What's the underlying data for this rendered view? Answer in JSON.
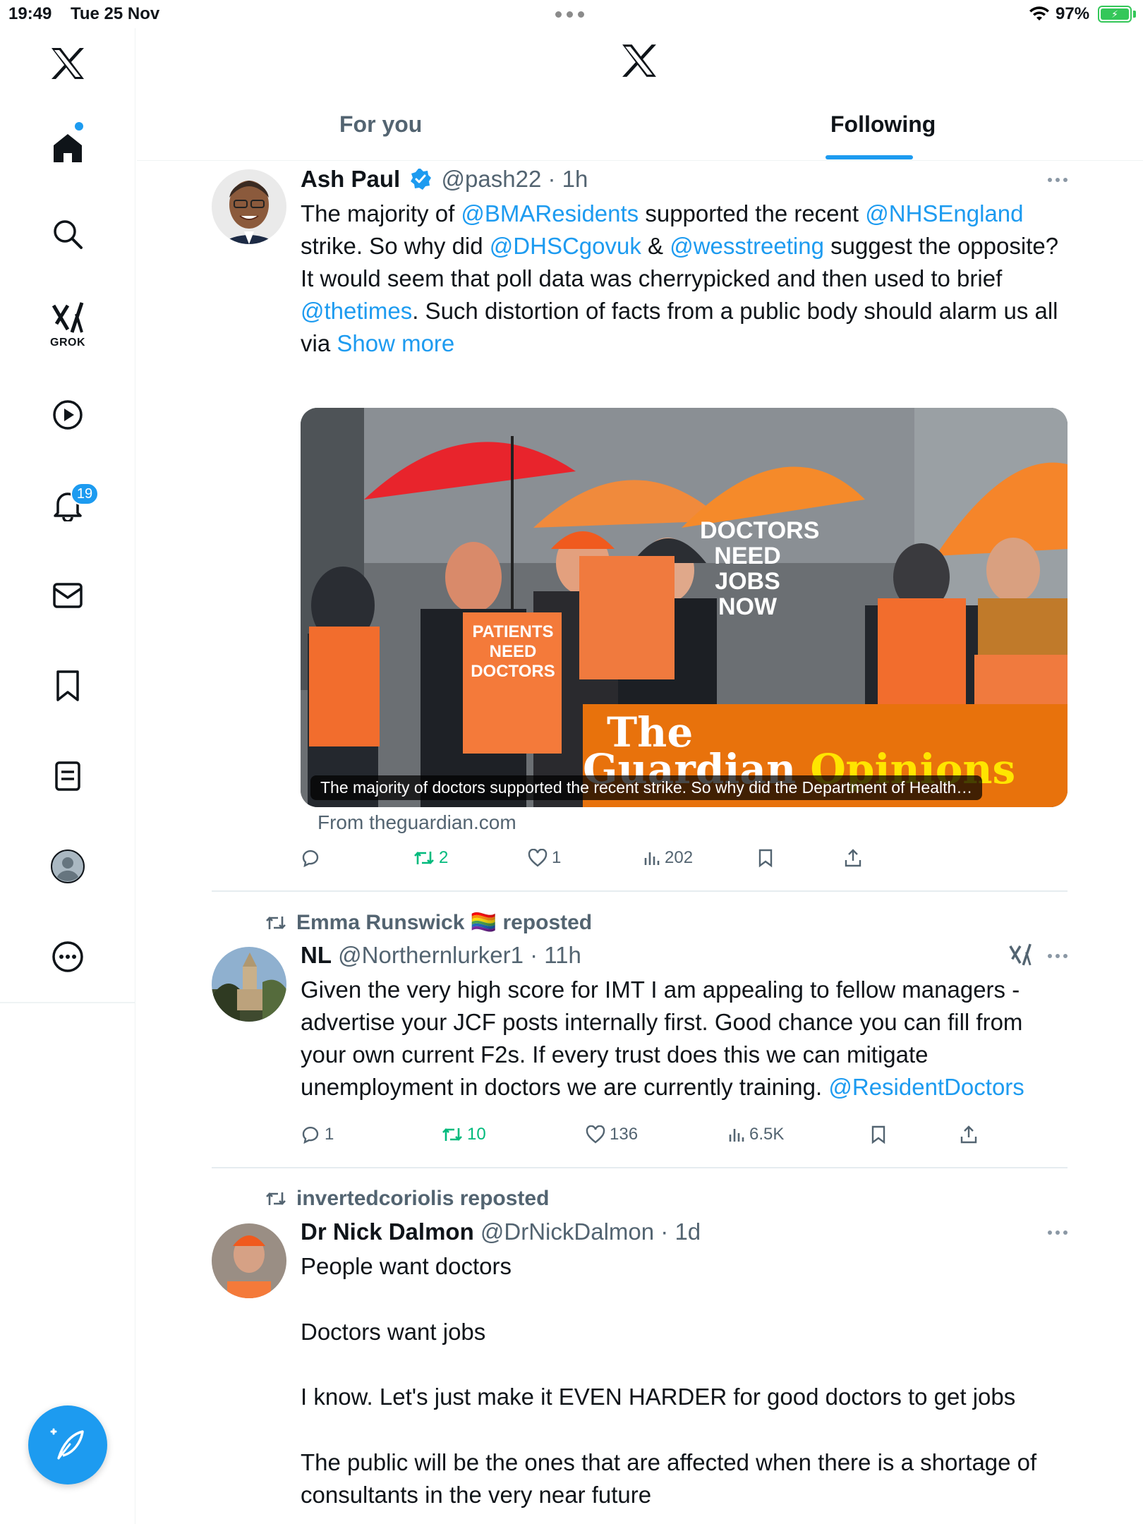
{
  "status_bar": {
    "time": "19:49",
    "date": "Tue 25 Nov",
    "battery": "97%"
  },
  "sidebar": {
    "grok_label": "GROK",
    "notifications_badge": "19",
    "items": [
      "x-logo",
      "home",
      "explore",
      "grok",
      "video",
      "notifications",
      "messages",
      "bookmarks",
      "lists",
      "profile",
      "more"
    ]
  },
  "header": {
    "tabs": [
      {
        "label": "For you"
      },
      {
        "label": "Following"
      }
    ],
    "active_tab": "Following"
  },
  "tweets": [
    {
      "name": "Ash Paul",
      "verified": true,
      "handle": "@pash22",
      "time": "· 1h",
      "text_parts": [
        {
          "t": "The majority of "
        },
        {
          "t": "@BMAResidents",
          "link": true
        },
        {
          "t": " supported the recent "
        },
        {
          "t": "@NHSEngland",
          "link": true
        },
        {
          "t": " strike. So why did "
        },
        {
          "t": "@DHSCgovuk",
          "link": true
        },
        {
          "t": " & "
        },
        {
          "t": "@wesstreeting",
          "link": true
        },
        {
          "t": " suggest the opposite?\nIt would seem that poll data was cherrypicked and then used to brief "
        },
        {
          "t": "@thetimes",
          "link": true
        },
        {
          "t": ". Such distortion of facts from a public body should alarm us all via "
        },
        {
          "t": "Show more",
          "link": true
        }
      ],
      "card": {
        "caption": "The majority of doctors supported the recent strike. So why did the Department of Health…",
        "source": "From theguardian.com",
        "sign_text": "DOCTORS NEED JOBS NOW",
        "sign2_text": "PATIENTS NEED DOCTORS",
        "brand_1": "The",
        "brand_2": "Guardian",
        "brand_3": "Opinions"
      },
      "actions": {
        "replies": "",
        "reposts": "2",
        "likes": "1",
        "views": "202"
      }
    },
    {
      "reposted_by": "Emma Runswick 🏳️‍🌈 reposted",
      "name": "NL",
      "handle": "@Northernlurker1",
      "time": "· 11h",
      "text_parts": [
        {
          "t": "Given the very high score for IMT I am appealing to fellow managers - advertise your JCF posts internally first. Good chance you can fill from your own current F2s. If every trust does this we can mitigate unemployment in doctors we are currently training. "
        },
        {
          "t": "@ResidentDoctors",
          "link": true
        }
      ],
      "actions": {
        "replies": "1",
        "reposts": "10",
        "likes": "136",
        "views": "6.5K"
      }
    },
    {
      "reposted_by": "invertedcoriolis reposted",
      "name": "Dr Nick Dalmon",
      "handle": "@DrNickDalmon",
      "time": "· 1d",
      "text_parts": [
        {
          "t": "People want doctors\n\nDoctors want jobs\n\nI know. Let's just make it EVEN HARDER for good doctors to get jobs\n\nThe public will be the ones that are affected when there is a shortage of consultants in the very near future"
        }
      ]
    }
  ],
  "colors": {
    "accent": "#1d9bf0",
    "repost_green": "#00ba7c",
    "muted": "#536471"
  }
}
